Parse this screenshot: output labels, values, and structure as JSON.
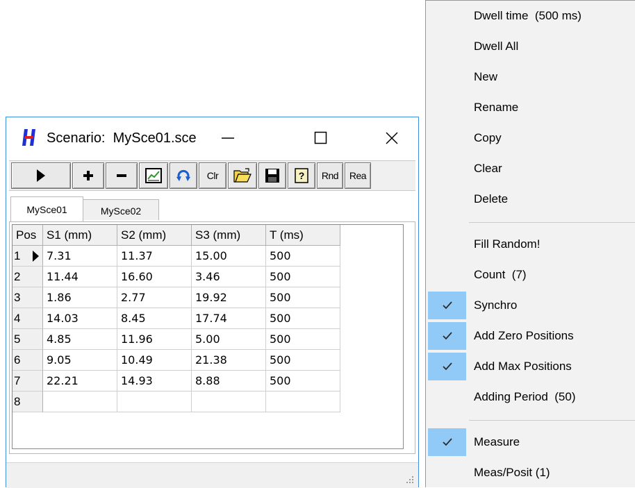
{
  "window": {
    "title": "Scenario:  MySce01.sce",
    "logo_letter": "H",
    "logo_color": "#1f2fd8",
    "logo_accent": "#e01e1e",
    "border_color": "#3c8fd8"
  },
  "toolbar": {
    "buttons": [
      {
        "name": "play-button",
        "icon": "play-icon"
      },
      {
        "name": "add-button",
        "icon": "plus-icon"
      },
      {
        "name": "remove-button",
        "icon": "minus-icon"
      },
      {
        "name": "chart-button",
        "icon": "chart-icon"
      },
      {
        "name": "refresh-button",
        "icon": "refresh-icon"
      },
      {
        "name": "clear-button",
        "label": "Clr"
      },
      {
        "name": "open-button",
        "icon": "folder-open-icon"
      },
      {
        "name": "save-button",
        "icon": "floppy-disk-icon"
      },
      {
        "name": "help-button",
        "icon": "help-icon"
      },
      {
        "name": "random-button",
        "label": "Rnd"
      },
      {
        "name": "read-button",
        "label": "Rea"
      }
    ]
  },
  "tabs": [
    {
      "label": "MySce01",
      "active": true
    },
    {
      "label": "MySce02",
      "active": false
    }
  ],
  "grid": {
    "columns": [
      "Pos",
      "S1 (mm)",
      "S2 (mm)",
      "S3 (mm)",
      "T (ms)"
    ],
    "rows": [
      [
        "1",
        "7.31",
        "11.37",
        "15.00",
        "500"
      ],
      [
        "2",
        "11.44",
        "16.60",
        "3.46",
        "500"
      ],
      [
        "3",
        "1.86",
        "2.77",
        "19.92",
        "500"
      ],
      [
        "4",
        "14.03",
        "8.45",
        "17.74",
        "500"
      ],
      [
        "5",
        "4.85",
        "11.96",
        "5.00",
        "500"
      ],
      [
        "6",
        "9.05",
        "10.49",
        "21.38",
        "500"
      ],
      [
        "7",
        "22.21",
        "14.93",
        "8.88",
        "500"
      ],
      [
        "8",
        "",
        "",
        "",
        ""
      ]
    ],
    "current_row": 1
  },
  "menu": {
    "check_color": "#91c9f7",
    "groups": [
      [
        {
          "label": "Dwell time  (500 ms)",
          "checked": false
        },
        {
          "label": "Dwell All",
          "checked": false
        },
        {
          "label": "New",
          "checked": false
        },
        {
          "label": "Rename",
          "checked": false
        },
        {
          "label": "Copy",
          "checked": false
        },
        {
          "label": "Clear",
          "checked": false
        },
        {
          "label": "Delete",
          "checked": false
        }
      ],
      [
        {
          "label": "Fill Random!",
          "checked": false
        },
        {
          "label": "Count  (7)",
          "checked": false
        },
        {
          "label": "Synchro",
          "checked": true
        },
        {
          "label": "Add Zero Positions",
          "checked": true
        },
        {
          "label": "Add Max Positions",
          "checked": true
        },
        {
          "label": "Adding Period  (50)",
          "checked": false
        }
      ],
      [
        {
          "label": "Measure",
          "checked": true
        },
        {
          "label": "Meas/Posit (1)",
          "checked": false
        }
      ]
    ]
  }
}
